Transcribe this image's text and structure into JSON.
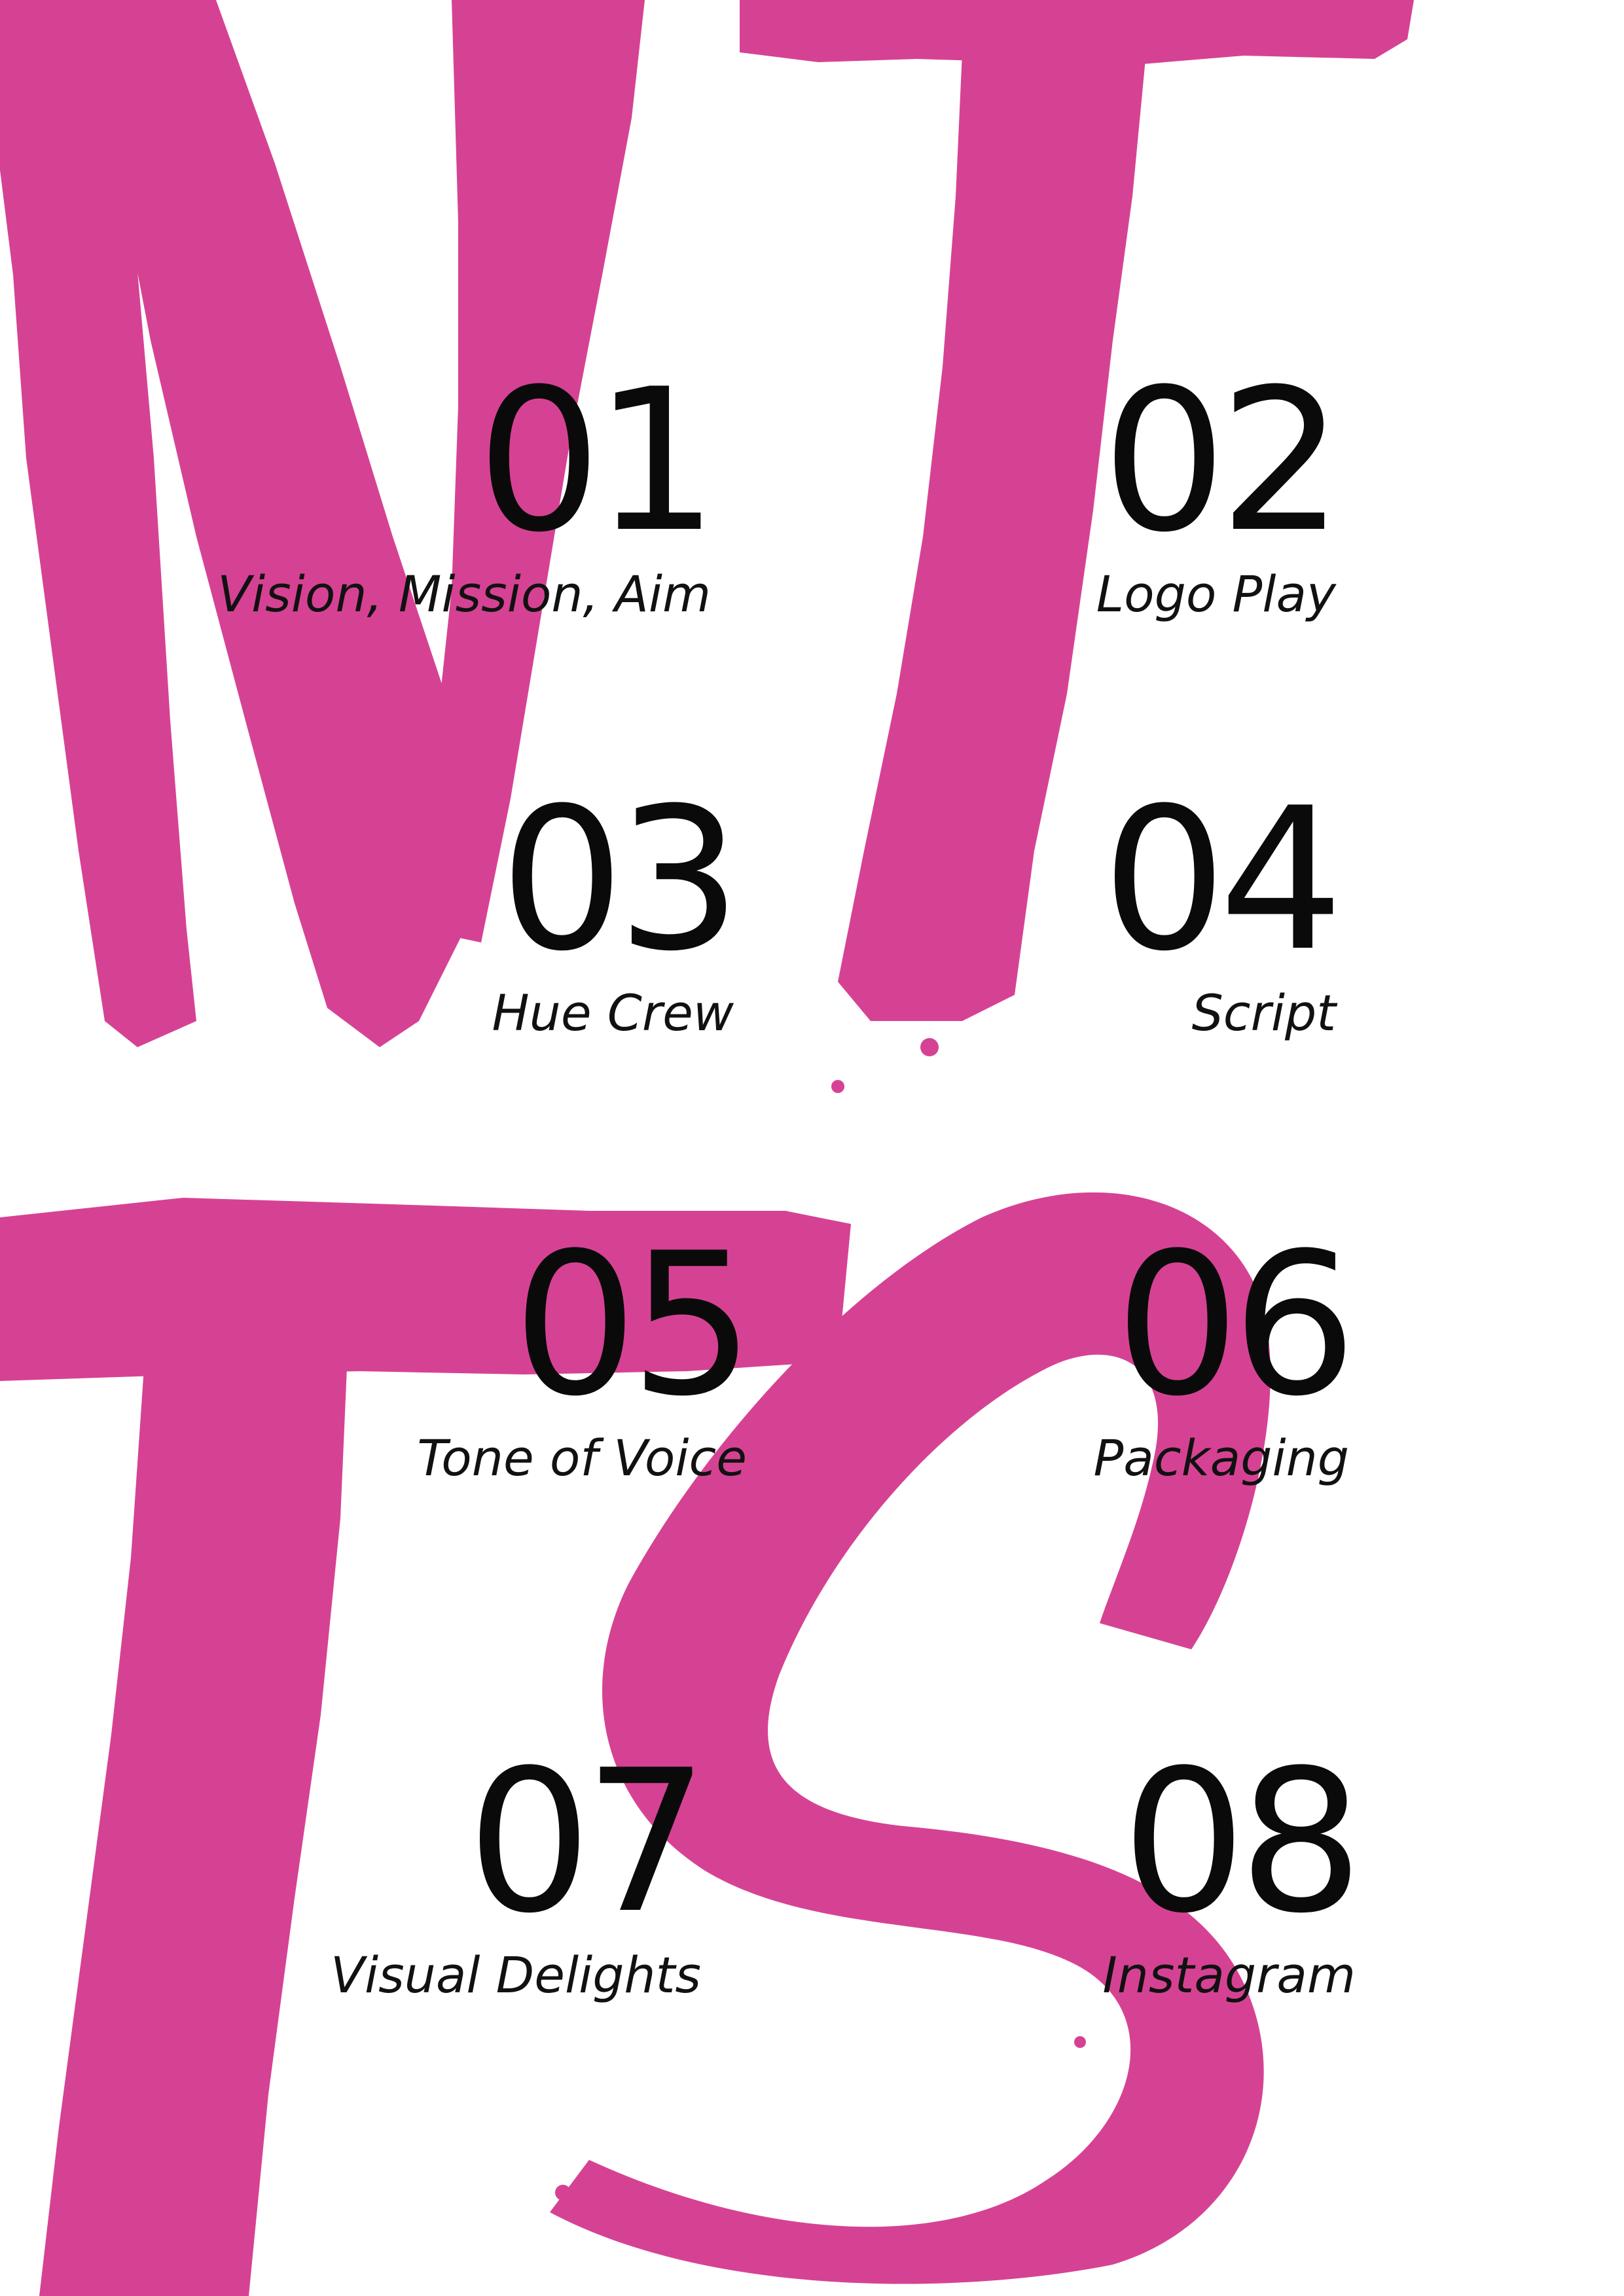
{
  "colors": {
    "brush_pink": "#d64293",
    "text": "#0a0a0a",
    "background": "#ffffff"
  },
  "artwork": {
    "description_icon": "brush-lettering-art"
  },
  "toc": [
    {
      "number": "01",
      "title": "Vision, Mission, Aim"
    },
    {
      "number": "02",
      "title": "Logo Play"
    },
    {
      "number": "03",
      "title": "Hue Crew"
    },
    {
      "number": "04",
      "title": "Script"
    },
    {
      "number": "05",
      "title": "Tone of Voice"
    },
    {
      "number": "06",
      "title": "Packaging"
    },
    {
      "number": "07",
      "title": "Visual Delights"
    },
    {
      "number": "08",
      "title": "Instagram"
    }
  ]
}
